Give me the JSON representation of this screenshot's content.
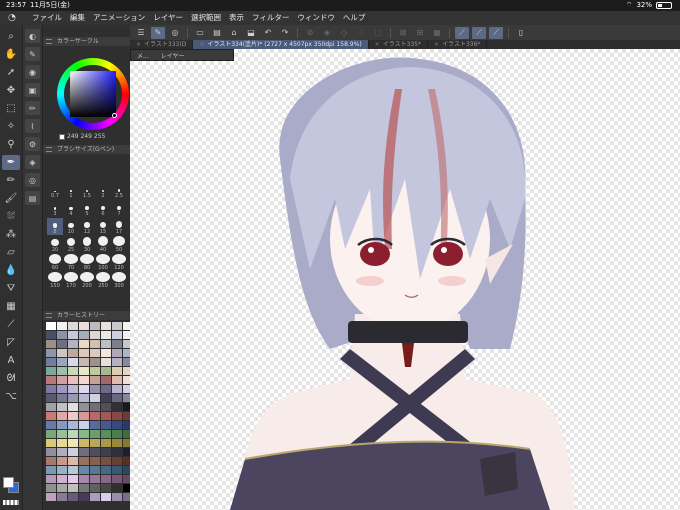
{
  "status": {
    "time": "23:57",
    "date": "11月5日(金)",
    "battery": "32%",
    "battery_level": 0.32
  },
  "menu": {
    "items": [
      "ファイル",
      "編集",
      "アニメーション",
      "レイヤー",
      "選択範囲",
      "表示",
      "フィルター",
      "ウィンドウ",
      "ヘルプ"
    ]
  },
  "tabs": [
    {
      "label": "イラスト333(D"
    },
    {
      "label": "イラスト334(塗片)* (2727 x 4507px 350dpi 158.9%)"
    },
    {
      "label": "イラスト335*"
    },
    {
      "label": "イラスト336*"
    }
  ],
  "popup": {
    "left": "メ...",
    "right": "レイヤー"
  },
  "palettes": {
    "color_circle_title": "カラーサークル",
    "color_values": [
      "249",
      "249",
      "255"
    ],
    "brush_size_title": "ブラシサイズ(Gペン)",
    "color_history_title": "カラーヒストリー"
  },
  "brush_sizes": [
    "0.7",
    "1",
    "1.5",
    "2",
    "2.5",
    "3",
    "4",
    "5",
    "6",
    "7",
    "8",
    "10",
    "12",
    "15",
    "17",
    "20",
    "25",
    "30",
    "40",
    "50",
    "60",
    "70",
    "80",
    "100",
    "120",
    "150",
    "170",
    "200",
    "250",
    "300"
  ],
  "selected_brush_size": "8",
  "colors": {
    "accent": "#5c6a86",
    "background_fg": "#ffffff",
    "background_bg": "#2b6bd8",
    "hair": "#b8bcd6",
    "dress": "#4b4560"
  },
  "color_history": [
    "#ffffff",
    "#f2f2f2",
    "#d9d9d9",
    "#e8dede",
    "#bcbcbc",
    "#e9e0e0",
    "#c9c9cc",
    "#f5f5f5",
    "#4a4e6a",
    "#8c90a8",
    "#c6c8db",
    "#a7adb8",
    "#dbd7d2",
    "#e9e9e9",
    "#cdd0e0",
    "#f0f0f5",
    "#9b8f8a",
    "#6f6e7e",
    "#b7b2c0",
    "#e8d8c8",
    "#d4c0b2",
    "#bfbfbf",
    "#7d7f8c",
    "#c5c8d0",
    "#8f94a8",
    "#cfc4c0",
    "#bfa8a0",
    "#e0c8b8",
    "#d9cbc2",
    "#f4e6dc",
    "#b0a8b8",
    "#a8b8c8",
    "#6d7ea0",
    "#9aa6c0",
    "#d8d8e8",
    "#c8b8b0",
    "#a09088",
    "#e8e0d8",
    "#b8b0c0",
    "#8888a0",
    "#7aa89a",
    "#9ec0a8",
    "#c8d8b8",
    "#e8e8c8",
    "#c0c8a0",
    "#a8b890",
    "#d8d0b0",
    "#e0d8c0",
    "#b87878",
    "#d0a0a0",
    "#e8c0c0",
    "#f0d8d0",
    "#c8a098",
    "#a06868",
    "#e0b8b0",
    "#f0e0d8",
    "#8078a0",
    "#a098c0",
    "#c0b8d8",
    "#e0d8f0",
    "#9890b0",
    "#706888",
    "#b8b0d0",
    "#d8d0e8",
    "#585870",
    "#787890",
    "#9898b0",
    "#b8b8d0",
    "#d0d0e0",
    "#404058",
    "#686880",
    "#888898",
    "#a0a0a8",
    "#c0c0c8",
    "#e0e0e0",
    "#909098",
    "#707078",
    "#505058",
    "#303038",
    "#181820",
    "#c87878",
    "#e0a8a8",
    "#f0c8c8",
    "#d89898",
    "#b86868",
    "#a05858",
    "#884848",
    "#703838",
    "#6878a8",
    "#8898c0",
    "#a8b8d8",
    "#c8d0e8",
    "#5868a0",
    "#485890",
    "#384880",
    "#283870",
    "#78a878",
    "#98c098",
    "#b8d8b8",
    "#88b888",
    "#68a068",
    "#589058",
    "#488048",
    "#387038",
    "#d8c878",
    "#e8d898",
    "#f0e8b8",
    "#c8b868",
    "#b8a858",
    "#a89848",
    "#988838",
    "#887828",
    "#8e8e9e",
    "#aeaebe",
    "#cecede",
    "#6e6e7e",
    "#4e4e5e",
    "#3e3e4e",
    "#2e2e3e",
    "#1e1e2e",
    "#a87868",
    "#c89888",
    "#e0b8a8",
    "#987060",
    "#886050",
    "#785040",
    "#684030",
    "#583020",
    "#7898b8",
    "#98b0c8",
    "#b8c8d8",
    "#6888a8",
    "#587898",
    "#486888",
    "#385878",
    "#284868",
    "#b898b8",
    "#d0b0d0",
    "#e8c8e8",
    "#a888a8",
    "#987898",
    "#886888",
    "#785878",
    "#684868",
    "#909090",
    "#a8a8a8",
    "#c0c0c0",
    "#787878",
    "#606060",
    "#484848",
    "#303030",
    "#000000",
    "#c0a0c0",
    "#8a7a9a",
    "#6a5a7a",
    "#4a3a5a",
    "#ac9cbc",
    "#dcccec",
    "#9c8cac",
    "#7c6c8c"
  ]
}
